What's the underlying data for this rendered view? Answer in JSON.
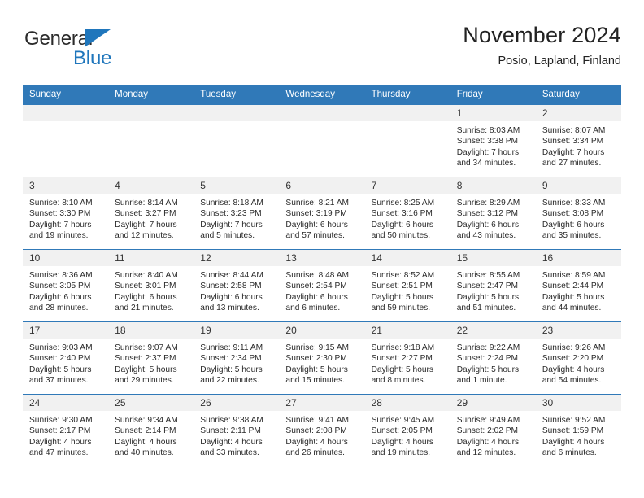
{
  "brand": {
    "name_part1": "General",
    "name_part2": "Blue",
    "accent_color": "#1f76bc"
  },
  "header": {
    "title": "November 2024",
    "subtitle": "Posio, Lapland, Finland"
  },
  "calendar": {
    "header_color": "#3079b8",
    "daynum_band_color": "#f1f1f1",
    "weekdays": [
      "Sunday",
      "Monday",
      "Tuesday",
      "Wednesday",
      "Thursday",
      "Friday",
      "Saturday"
    ],
    "labels": {
      "sunrise": "Sunrise:",
      "sunset": "Sunset:",
      "daylight": "Daylight:"
    },
    "weeks": [
      [
        {
          "day": "",
          "empty": true
        },
        {
          "day": "",
          "empty": true
        },
        {
          "day": "",
          "empty": true
        },
        {
          "day": "",
          "empty": true
        },
        {
          "day": "",
          "empty": true
        },
        {
          "day": "1",
          "sunrise": "Sunrise: 8:03 AM",
          "sunset": "Sunset: 3:38 PM",
          "daylight1": "Daylight: 7 hours",
          "daylight2": "and 34 minutes."
        },
        {
          "day": "2",
          "sunrise": "Sunrise: 8:07 AM",
          "sunset": "Sunset: 3:34 PM",
          "daylight1": "Daylight: 7 hours",
          "daylight2": "and 27 minutes."
        }
      ],
      [
        {
          "day": "3",
          "sunrise": "Sunrise: 8:10 AM",
          "sunset": "Sunset: 3:30 PM",
          "daylight1": "Daylight: 7 hours",
          "daylight2": "and 19 minutes."
        },
        {
          "day": "4",
          "sunrise": "Sunrise: 8:14 AM",
          "sunset": "Sunset: 3:27 PM",
          "daylight1": "Daylight: 7 hours",
          "daylight2": "and 12 minutes."
        },
        {
          "day": "5",
          "sunrise": "Sunrise: 8:18 AM",
          "sunset": "Sunset: 3:23 PM",
          "daylight1": "Daylight: 7 hours",
          "daylight2": "and 5 minutes."
        },
        {
          "day": "6",
          "sunrise": "Sunrise: 8:21 AM",
          "sunset": "Sunset: 3:19 PM",
          "daylight1": "Daylight: 6 hours",
          "daylight2": "and 57 minutes."
        },
        {
          "day": "7",
          "sunrise": "Sunrise: 8:25 AM",
          "sunset": "Sunset: 3:16 PM",
          "daylight1": "Daylight: 6 hours",
          "daylight2": "and 50 minutes."
        },
        {
          "day": "8",
          "sunrise": "Sunrise: 8:29 AM",
          "sunset": "Sunset: 3:12 PM",
          "daylight1": "Daylight: 6 hours",
          "daylight2": "and 43 minutes."
        },
        {
          "day": "9",
          "sunrise": "Sunrise: 8:33 AM",
          "sunset": "Sunset: 3:08 PM",
          "daylight1": "Daylight: 6 hours",
          "daylight2": "and 35 minutes."
        }
      ],
      [
        {
          "day": "10",
          "sunrise": "Sunrise: 8:36 AM",
          "sunset": "Sunset: 3:05 PM",
          "daylight1": "Daylight: 6 hours",
          "daylight2": "and 28 minutes."
        },
        {
          "day": "11",
          "sunrise": "Sunrise: 8:40 AM",
          "sunset": "Sunset: 3:01 PM",
          "daylight1": "Daylight: 6 hours",
          "daylight2": "and 21 minutes."
        },
        {
          "day": "12",
          "sunrise": "Sunrise: 8:44 AM",
          "sunset": "Sunset: 2:58 PM",
          "daylight1": "Daylight: 6 hours",
          "daylight2": "and 13 minutes."
        },
        {
          "day": "13",
          "sunrise": "Sunrise: 8:48 AM",
          "sunset": "Sunset: 2:54 PM",
          "daylight1": "Daylight: 6 hours",
          "daylight2": "and 6 minutes."
        },
        {
          "day": "14",
          "sunrise": "Sunrise: 8:52 AM",
          "sunset": "Sunset: 2:51 PM",
          "daylight1": "Daylight: 5 hours",
          "daylight2": "and 59 minutes."
        },
        {
          "day": "15",
          "sunrise": "Sunrise: 8:55 AM",
          "sunset": "Sunset: 2:47 PM",
          "daylight1": "Daylight: 5 hours",
          "daylight2": "and 51 minutes."
        },
        {
          "day": "16",
          "sunrise": "Sunrise: 8:59 AM",
          "sunset": "Sunset: 2:44 PM",
          "daylight1": "Daylight: 5 hours",
          "daylight2": "and 44 minutes."
        }
      ],
      [
        {
          "day": "17",
          "sunrise": "Sunrise: 9:03 AM",
          "sunset": "Sunset: 2:40 PM",
          "daylight1": "Daylight: 5 hours",
          "daylight2": "and 37 minutes."
        },
        {
          "day": "18",
          "sunrise": "Sunrise: 9:07 AM",
          "sunset": "Sunset: 2:37 PM",
          "daylight1": "Daylight: 5 hours",
          "daylight2": "and 29 minutes."
        },
        {
          "day": "19",
          "sunrise": "Sunrise: 9:11 AM",
          "sunset": "Sunset: 2:34 PM",
          "daylight1": "Daylight: 5 hours",
          "daylight2": "and 22 minutes."
        },
        {
          "day": "20",
          "sunrise": "Sunrise: 9:15 AM",
          "sunset": "Sunset: 2:30 PM",
          "daylight1": "Daylight: 5 hours",
          "daylight2": "and 15 minutes."
        },
        {
          "day": "21",
          "sunrise": "Sunrise: 9:18 AM",
          "sunset": "Sunset: 2:27 PM",
          "daylight1": "Daylight: 5 hours",
          "daylight2": "and 8 minutes."
        },
        {
          "day": "22",
          "sunrise": "Sunrise: 9:22 AM",
          "sunset": "Sunset: 2:24 PM",
          "daylight1": "Daylight: 5 hours",
          "daylight2": "and 1 minute."
        },
        {
          "day": "23",
          "sunrise": "Sunrise: 9:26 AM",
          "sunset": "Sunset: 2:20 PM",
          "daylight1": "Daylight: 4 hours",
          "daylight2": "and 54 minutes."
        }
      ],
      [
        {
          "day": "24",
          "sunrise": "Sunrise: 9:30 AM",
          "sunset": "Sunset: 2:17 PM",
          "daylight1": "Daylight: 4 hours",
          "daylight2": "and 47 minutes."
        },
        {
          "day": "25",
          "sunrise": "Sunrise: 9:34 AM",
          "sunset": "Sunset: 2:14 PM",
          "daylight1": "Daylight: 4 hours",
          "daylight2": "and 40 minutes."
        },
        {
          "day": "26",
          "sunrise": "Sunrise: 9:38 AM",
          "sunset": "Sunset: 2:11 PM",
          "daylight1": "Daylight: 4 hours",
          "daylight2": "and 33 minutes."
        },
        {
          "day": "27",
          "sunrise": "Sunrise: 9:41 AM",
          "sunset": "Sunset: 2:08 PM",
          "daylight1": "Daylight: 4 hours",
          "daylight2": "and 26 minutes."
        },
        {
          "day": "28",
          "sunrise": "Sunrise: 9:45 AM",
          "sunset": "Sunset: 2:05 PM",
          "daylight1": "Daylight: 4 hours",
          "daylight2": "and 19 minutes."
        },
        {
          "day": "29",
          "sunrise": "Sunrise: 9:49 AM",
          "sunset": "Sunset: 2:02 PM",
          "daylight1": "Daylight: 4 hours",
          "daylight2": "and 12 minutes."
        },
        {
          "day": "30",
          "sunrise": "Sunrise: 9:52 AM",
          "sunset": "Sunset: 1:59 PM",
          "daylight1": "Daylight: 4 hours",
          "daylight2": "and 6 minutes."
        }
      ]
    ]
  }
}
